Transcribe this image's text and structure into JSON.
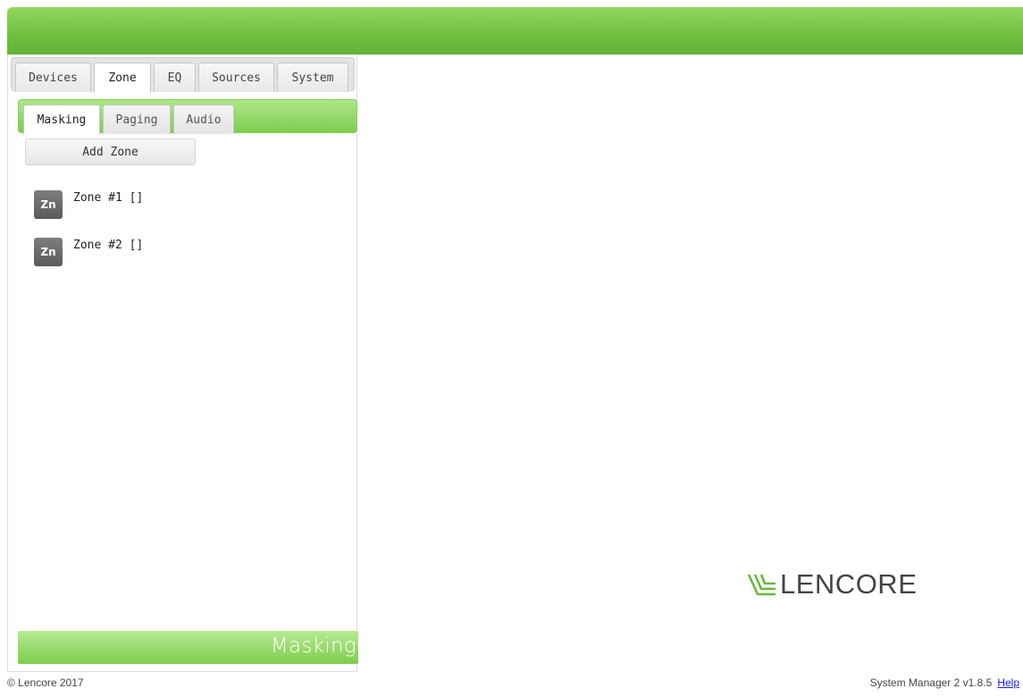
{
  "header": {
    "color": "#6fbf3f"
  },
  "main_tabs": [
    {
      "label": "Devices",
      "active": false
    },
    {
      "label": "Zone",
      "active": true
    },
    {
      "label": "EQ",
      "active": false
    },
    {
      "label": "Sources",
      "active": false
    },
    {
      "label": "System",
      "active": false
    }
  ],
  "sub_tabs": [
    {
      "label": "Masking",
      "active": true
    },
    {
      "label": "Paging",
      "active": false
    },
    {
      "label": "Audio",
      "active": false
    }
  ],
  "add_zone_label": "Add Zone",
  "zones": [
    {
      "icon_text": "Zn",
      "label": "Zone #1 []"
    },
    {
      "icon_text": "Zn",
      "label": "Zone #2 []"
    }
  ],
  "status_label": "Masking",
  "logo": {
    "text": "LENCORE",
    "icon": "lencore-wave-icon",
    "mark_color": "#6ab540"
  },
  "footer": {
    "copyright": "© Lencore 2017",
    "version": "System Manager 2 v1.8.5",
    "help_label": "Help"
  },
  "colors": {
    "accent": "#6fbf3f",
    "accent_light": "#b6ea93",
    "link": "#1a1ae6"
  }
}
